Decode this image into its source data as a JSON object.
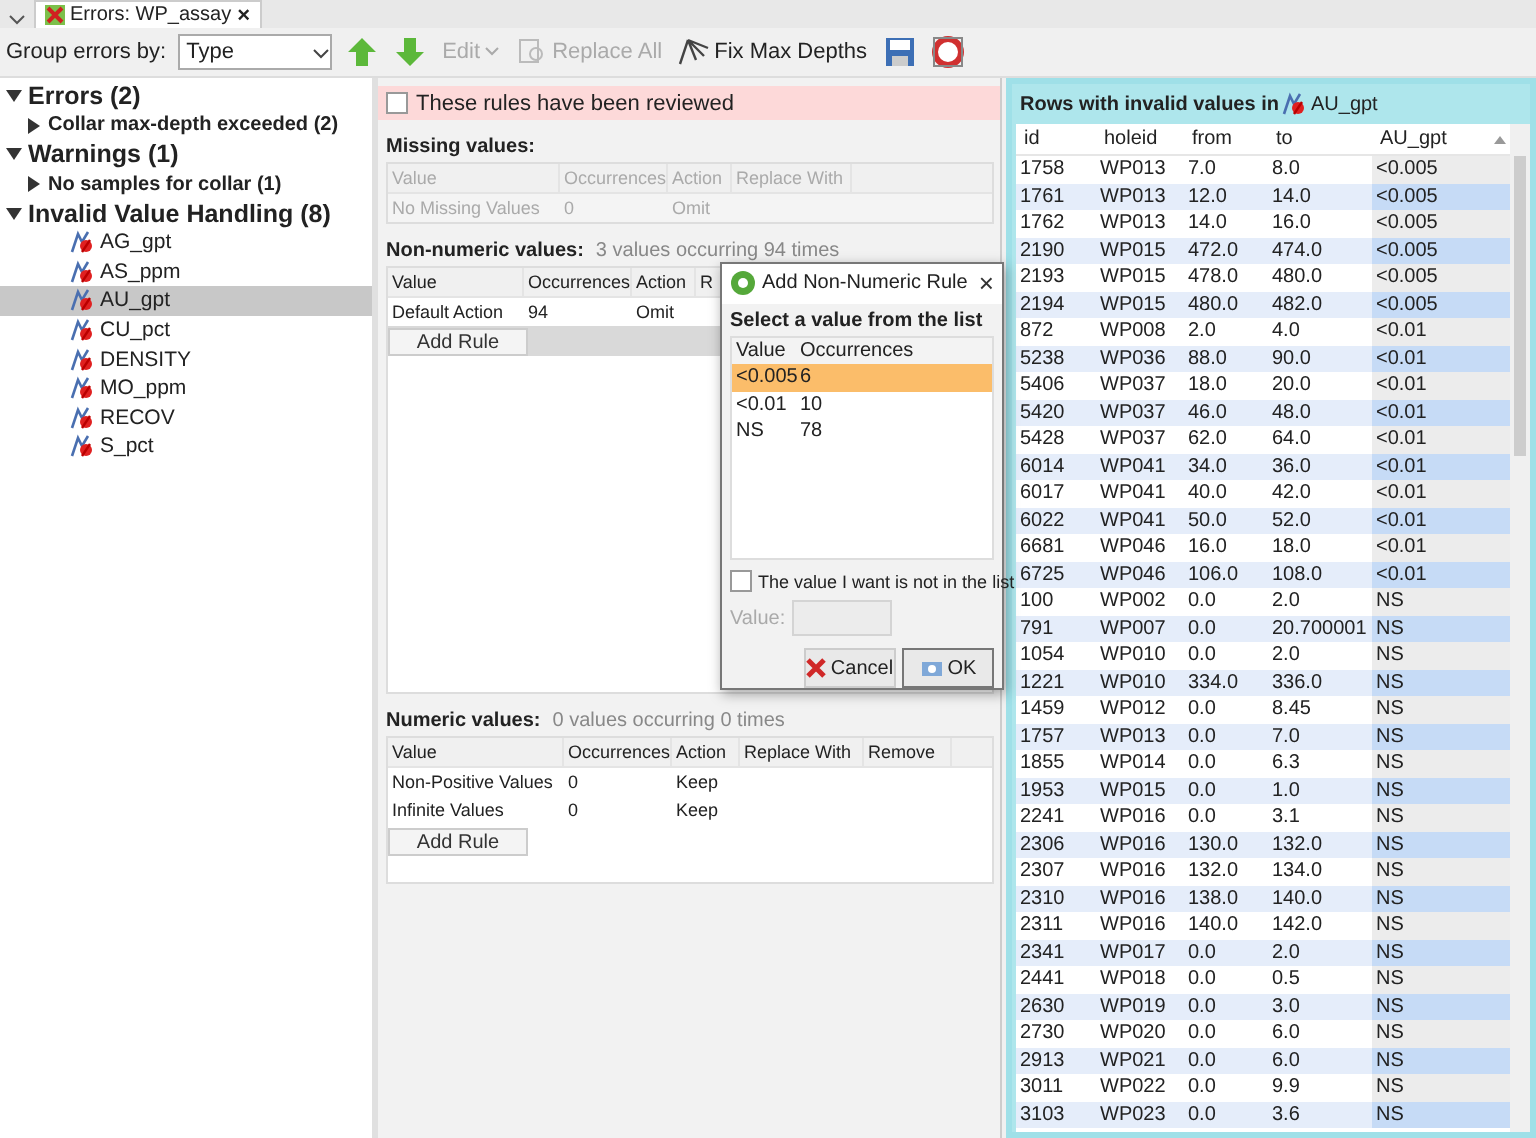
{
  "tab": {
    "label": "Errors: WP_assay",
    "close": "×"
  },
  "toolbar": {
    "group_label": "Group errors by:",
    "group_value": "Type",
    "buttons": [
      {
        "kind": "up"
      },
      {
        "kind": "down"
      },
      {
        "kind": "menu",
        "label": "Edit",
        "disabled": true
      },
      {
        "kind": "replace",
        "label": "Replace All",
        "disabled": true
      },
      {
        "kind": "fix",
        "label": "Fix Max Depths",
        "disabled": false
      },
      {
        "kind": "save"
      },
      {
        "kind": "help"
      }
    ]
  },
  "tree": [
    {
      "kind": "group",
      "label": "Errors (2)",
      "expanded": true,
      "selected": false,
      "children": [
        {
          "kind": "category",
          "label": "Collar max-depth exceeded (2)",
          "expanded": false,
          "selected": false
        }
      ]
    },
    {
      "kind": "group",
      "label": "Warnings (1)",
      "expanded": true,
      "selected": false,
      "children": [
        {
          "kind": "category",
          "label": "No samples for collar (1)",
          "expanded": false,
          "selected": false
        }
      ]
    },
    {
      "kind": "group",
      "label": "Invalid Value Handling (8)",
      "expanded": true,
      "selected": false,
      "children": [
        {
          "kind": "field",
          "label": "AG_gpt",
          "selected": false
        },
        {
          "kind": "field",
          "label": "AS_ppm",
          "selected": false
        },
        {
          "kind": "field",
          "label": "AU_gpt",
          "selected": true
        },
        {
          "kind": "field",
          "label": "CU_pct",
          "selected": false
        },
        {
          "kind": "field",
          "label": "DENSITY",
          "selected": false
        },
        {
          "kind": "field",
          "label": "MO_ppm",
          "selected": false
        },
        {
          "kind": "field",
          "label": "RECOV",
          "selected": false
        },
        {
          "kind": "field",
          "label": "S_pct",
          "selected": false
        }
      ]
    }
  ],
  "reviewed": {
    "label": "These rules have been reviewed",
    "checked": false
  },
  "missing": {
    "title": "Missing values:",
    "disabled": true,
    "columns": [
      "Value",
      "Occurrences",
      "Action",
      "Replace With"
    ],
    "rows": [
      {
        "value": "No Missing Values",
        "occurrences": "0",
        "action": "Omit"
      }
    ]
  },
  "non_numeric": {
    "title": "Non-numeric values:",
    "summary": "3 values occurring 94 times",
    "columns": [
      "Value",
      "Occurrences",
      "Action",
      "R"
    ],
    "rows": [
      {
        "value": "Default Action",
        "occurrences": "94",
        "action": "Omit"
      }
    ],
    "add_button": "Add Rule"
  },
  "numeric": {
    "title": "Numeric values:",
    "summary": "0 values occurring 0 times",
    "columns": [
      "Value",
      "Occurrences",
      "Action",
      "Replace With",
      "Remove"
    ],
    "rows": [
      {
        "value": "Non-Positive Values",
        "occurrences": "0",
        "action": "Keep"
      },
      {
        "value": "Infinite Values",
        "occurrences": "0",
        "action": "Keep"
      }
    ],
    "add_button": "Add Rule"
  },
  "dialog": {
    "title": "Add Non-Numeric Rule",
    "close": "×",
    "prompt": "Select a value from the list",
    "columns": [
      "Value",
      "Occurrences"
    ],
    "rows": [
      {
        "value": "<0.005",
        "occurrences": "6",
        "selected": true
      },
      {
        "value": "<0.01",
        "occurrences": "10",
        "selected": false
      },
      {
        "value": "NS",
        "occurrences": "78",
        "selected": false
      }
    ],
    "not_in_list": {
      "label": "The value I want is not in the list",
      "checked": false
    },
    "value_field": {
      "label": "Value:",
      "disabled": true
    },
    "buttons": [
      {
        "kind": "cancel",
        "label": "Cancel"
      },
      {
        "kind": "ok",
        "label": "OK"
      }
    ]
  },
  "invalid_rows": {
    "title": "Rows with invalid values in",
    "field": "AU_gpt",
    "columns": [
      {
        "label": "id",
        "sorted": false
      },
      {
        "label": "holeid",
        "sorted": false
      },
      {
        "label": "from",
        "sorted": false
      },
      {
        "label": "to",
        "sorted": false
      },
      {
        "label": "AU_gpt",
        "sorted": true
      }
    ],
    "rows": [
      [
        "1758",
        "WP013",
        "7.0",
        "8.0",
        "<0.005"
      ],
      [
        "1761",
        "WP013",
        "12.0",
        "14.0",
        "<0.005"
      ],
      [
        "1762",
        "WP013",
        "14.0",
        "16.0",
        "<0.005"
      ],
      [
        "2190",
        "WP015",
        "472.0",
        "474.0",
        "<0.005"
      ],
      [
        "2193",
        "WP015",
        "478.0",
        "480.0",
        "<0.005"
      ],
      [
        "2194",
        "WP015",
        "480.0",
        "482.0",
        "<0.005"
      ],
      [
        "872",
        "WP008",
        "2.0",
        "4.0",
        "<0.01"
      ],
      [
        "5238",
        "WP036",
        "88.0",
        "90.0",
        "<0.01"
      ],
      [
        "5406",
        "WP037",
        "18.0",
        "20.0",
        "<0.01"
      ],
      [
        "5420",
        "WP037",
        "46.0",
        "48.0",
        "<0.01"
      ],
      [
        "5428",
        "WP037",
        "62.0",
        "64.0",
        "<0.01"
      ],
      [
        "6014",
        "WP041",
        "34.0",
        "36.0",
        "<0.01"
      ],
      [
        "6017",
        "WP041",
        "40.0",
        "42.0",
        "<0.01"
      ],
      [
        "6022",
        "WP041",
        "50.0",
        "52.0",
        "<0.01"
      ],
      [
        "6681",
        "WP046",
        "16.0",
        "18.0",
        "<0.01"
      ],
      [
        "6725",
        "WP046",
        "106.0",
        "108.0",
        "<0.01"
      ],
      [
        "100",
        "WP002",
        "0.0",
        "2.0",
        "NS"
      ],
      [
        "791",
        "WP007",
        "0.0",
        "20.700001",
        "NS"
      ],
      [
        "1054",
        "WP010",
        "0.0",
        "2.0",
        "NS"
      ],
      [
        "1221",
        "WP010",
        "334.0",
        "336.0",
        "NS"
      ],
      [
        "1459",
        "WP012",
        "0.0",
        "8.45",
        "NS"
      ],
      [
        "1757",
        "WP013",
        "0.0",
        "7.0",
        "NS"
      ],
      [
        "1855",
        "WP014",
        "0.0",
        "6.3",
        "NS"
      ],
      [
        "1953",
        "WP015",
        "0.0",
        "1.0",
        "NS"
      ],
      [
        "2241",
        "WP016",
        "0.0",
        "3.1",
        "NS"
      ],
      [
        "2306",
        "WP016",
        "130.0",
        "132.0",
        "NS"
      ],
      [
        "2307",
        "WP016",
        "132.0",
        "134.0",
        "NS"
      ],
      [
        "2310",
        "WP016",
        "138.0",
        "140.0",
        "NS"
      ],
      [
        "2311",
        "WP016",
        "140.0",
        "142.0",
        "NS"
      ],
      [
        "2341",
        "WP017",
        "0.0",
        "2.0",
        "NS"
      ],
      [
        "2441",
        "WP018",
        "0.0",
        "0.5",
        "NS"
      ],
      [
        "2630",
        "WP019",
        "0.0",
        "3.0",
        "NS"
      ],
      [
        "2730",
        "WP020",
        "0.0",
        "6.0",
        "NS"
      ],
      [
        "2913",
        "WP021",
        "0.0",
        "6.0",
        "NS"
      ],
      [
        "3011",
        "WP022",
        "0.0",
        "9.9",
        "NS"
      ],
      [
        "3103",
        "WP023",
        "0.0",
        "3.6",
        "NS"
      ]
    ]
  }
}
